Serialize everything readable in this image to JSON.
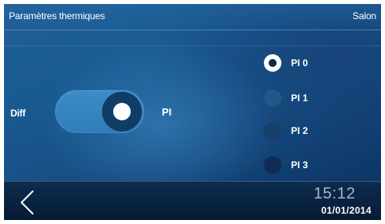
{
  "header": {
    "title": "Paramètres thermiques",
    "room": "Salon"
  },
  "control": {
    "label": "Diff",
    "toggle_state": "on",
    "mode_label": "PI"
  },
  "options": [
    {
      "label": "PI 0",
      "selected": true,
      "color": "#ffffff"
    },
    {
      "label": "PI 1",
      "selected": false,
      "color": "#1f5a86"
    },
    {
      "label": "PI 2",
      "selected": false,
      "color": "#183f6a"
    },
    {
      "label": "PI 3",
      "selected": false,
      "color": "#102c52"
    }
  ],
  "footer": {
    "back_icon": "chevron-left-icon",
    "time": "15:12",
    "date": "01/01/2014"
  },
  "colors": {
    "toggle_track": "#3689c4",
    "knob": "#0f3d66",
    "background_top": "#1f5f96",
    "background_bottom": "#0b2f5c",
    "footer": "#071d38"
  }
}
